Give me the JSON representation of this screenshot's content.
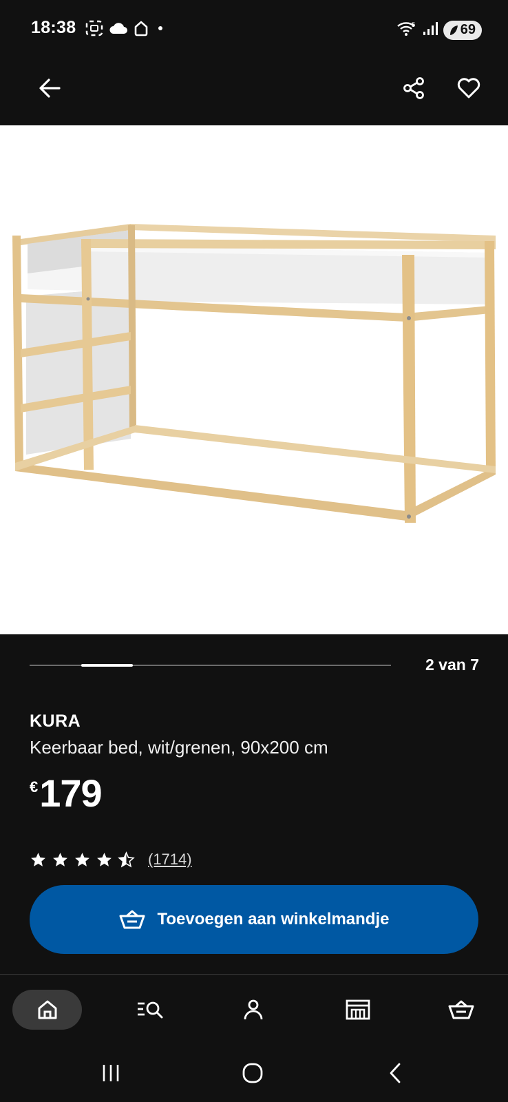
{
  "status_bar": {
    "time": "18:38",
    "battery": "69",
    "icons": [
      "screenshot-icon",
      "cloud-icon",
      "home-outline-icon",
      "wifi-icon",
      "signal-icon",
      "battery-icon"
    ]
  },
  "app_bar": {
    "icons": [
      "back-arrow-icon",
      "share-icon",
      "heart-icon"
    ]
  },
  "carousel": {
    "counter": "2 van 7",
    "current": 2,
    "total": 7
  },
  "product": {
    "name": "KURA",
    "description": "Keerbaar bed, wit/grenen, 90x200 cm",
    "price_currency": "€",
    "price_value": "179",
    "rating": 4.5,
    "rating_max": 5,
    "review_count": "(1714)"
  },
  "add_to_cart": {
    "label": "Toevoegen aan winkelmandje",
    "icon": "cart-icon",
    "color": "#0058a3"
  },
  "bottom_nav": {
    "items": [
      "home-icon",
      "search-list-icon",
      "account-icon",
      "store-icon",
      "cart-icon"
    ],
    "active": "home"
  },
  "system_nav": {
    "items": [
      "recents-icon",
      "home-circle-icon",
      "back-chevron-icon"
    ]
  },
  "colors": {
    "background": "#111111",
    "accent": "#0058a3",
    "wood": "#e3c796"
  }
}
